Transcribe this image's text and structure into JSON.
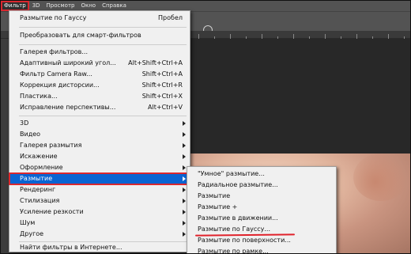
{
  "menubar": {
    "items": [
      {
        "label": "Фильтр",
        "active": true
      },
      {
        "label": "3D"
      },
      {
        "label": "Просмотр"
      },
      {
        "label": "Окно"
      },
      {
        "label": "Справка"
      }
    ]
  },
  "filter_menu": {
    "items": [
      {
        "label": "Размытие по Гауссу",
        "shortcut": "Пробел"
      },
      {
        "label": "Преобразовать для смарт-фильтров"
      },
      {
        "label": "Галерея фильтров..."
      },
      {
        "label": "Адаптивный широкий угол...",
        "shortcut": "Alt+Shift+Ctrl+A"
      },
      {
        "label": "Фильтр Camera Raw...",
        "shortcut": "Shift+Ctrl+A"
      },
      {
        "label": "Коррекция дисторсии...",
        "shortcut": "Shift+Ctrl+R"
      },
      {
        "label": "Пластика...",
        "shortcut": "Shift+Ctrl+X"
      },
      {
        "label": "Исправление перспективы...",
        "shortcut": "Alt+Ctrl+V"
      },
      {
        "label": "3D",
        "submenu": true
      },
      {
        "label": "Видео",
        "submenu": true
      },
      {
        "label": "Галерея размытия",
        "submenu": true
      },
      {
        "label": "Искажение",
        "submenu": true
      },
      {
        "label": "Оформление",
        "submenu": true
      },
      {
        "label": "Размытие",
        "submenu": true,
        "highlighted": true
      },
      {
        "label": "Рендеринг",
        "submenu": true
      },
      {
        "label": "Стилизация",
        "submenu": true
      },
      {
        "label": "Усиление резкости",
        "submenu": true
      },
      {
        "label": "Шум",
        "submenu": true
      },
      {
        "label": "Другое",
        "submenu": true
      },
      {
        "label": "Найти фильтры в Интернете..."
      }
    ]
  },
  "blur_submenu": {
    "items": [
      {
        "label": "\"Умное\" размытие..."
      },
      {
        "label": "Радиальное размытие..."
      },
      {
        "label": "Размытие"
      },
      {
        "label": "Размытие +"
      },
      {
        "label": "Размытие в движении..."
      },
      {
        "label": "Размытие по Гауссу...",
        "underlined": true
      },
      {
        "label": "Размытие по поверхности..."
      },
      {
        "label": "Размытие по рамке..."
      }
    ]
  },
  "colors": {
    "highlight": "#0a64d2",
    "annotation_red": "#d9282f",
    "menu_bg": "#f0f0f0",
    "app_bg": "#282828"
  }
}
